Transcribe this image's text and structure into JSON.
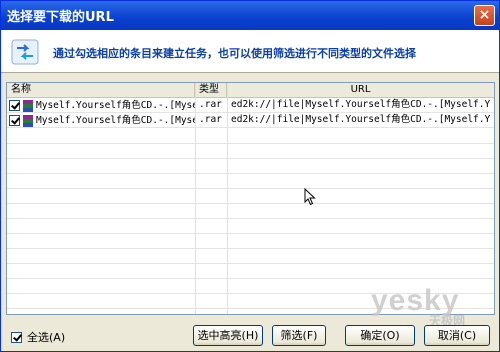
{
  "window": {
    "title": "选择要下载的URL",
    "close_glyph": "×"
  },
  "banner": {
    "icon": "link-arrows-icon",
    "text": "通过勾选相应的条目来建立任务，也可以使用筛选进行不同类型的文件选择"
  },
  "list": {
    "columns": [
      "名称",
      "类型",
      "URL"
    ],
    "rows": [
      {
        "checked": true,
        "name": "Myself.Yourself角色CD.-.[Myse",
        "type": ".rar",
        "url": "ed2k://|file|Myself.Yourself角色CD.-.[Myself.Y"
      },
      {
        "checked": true,
        "name": "Myself.Yourself角色CD.-.[Myse",
        "type": ".rar",
        "url": "ed2k://|file|Myself.Yourself角色CD.-.[Myself.Y"
      }
    ]
  },
  "footer": {
    "select_all_checked": true,
    "select_all_label": "全选(A)",
    "buttons": {
      "select_highlight": "选中高亮(H)",
      "filter": "筛选(F)",
      "ok": "确定(O)",
      "cancel": "取消(C)"
    }
  },
  "watermark": {
    "main": "yesky",
    "sub": "天极网"
  },
  "colors": {
    "titlebar": "#0a3fcf",
    "banner_text": "#0b3fa8",
    "button_border": "#003c74"
  }
}
